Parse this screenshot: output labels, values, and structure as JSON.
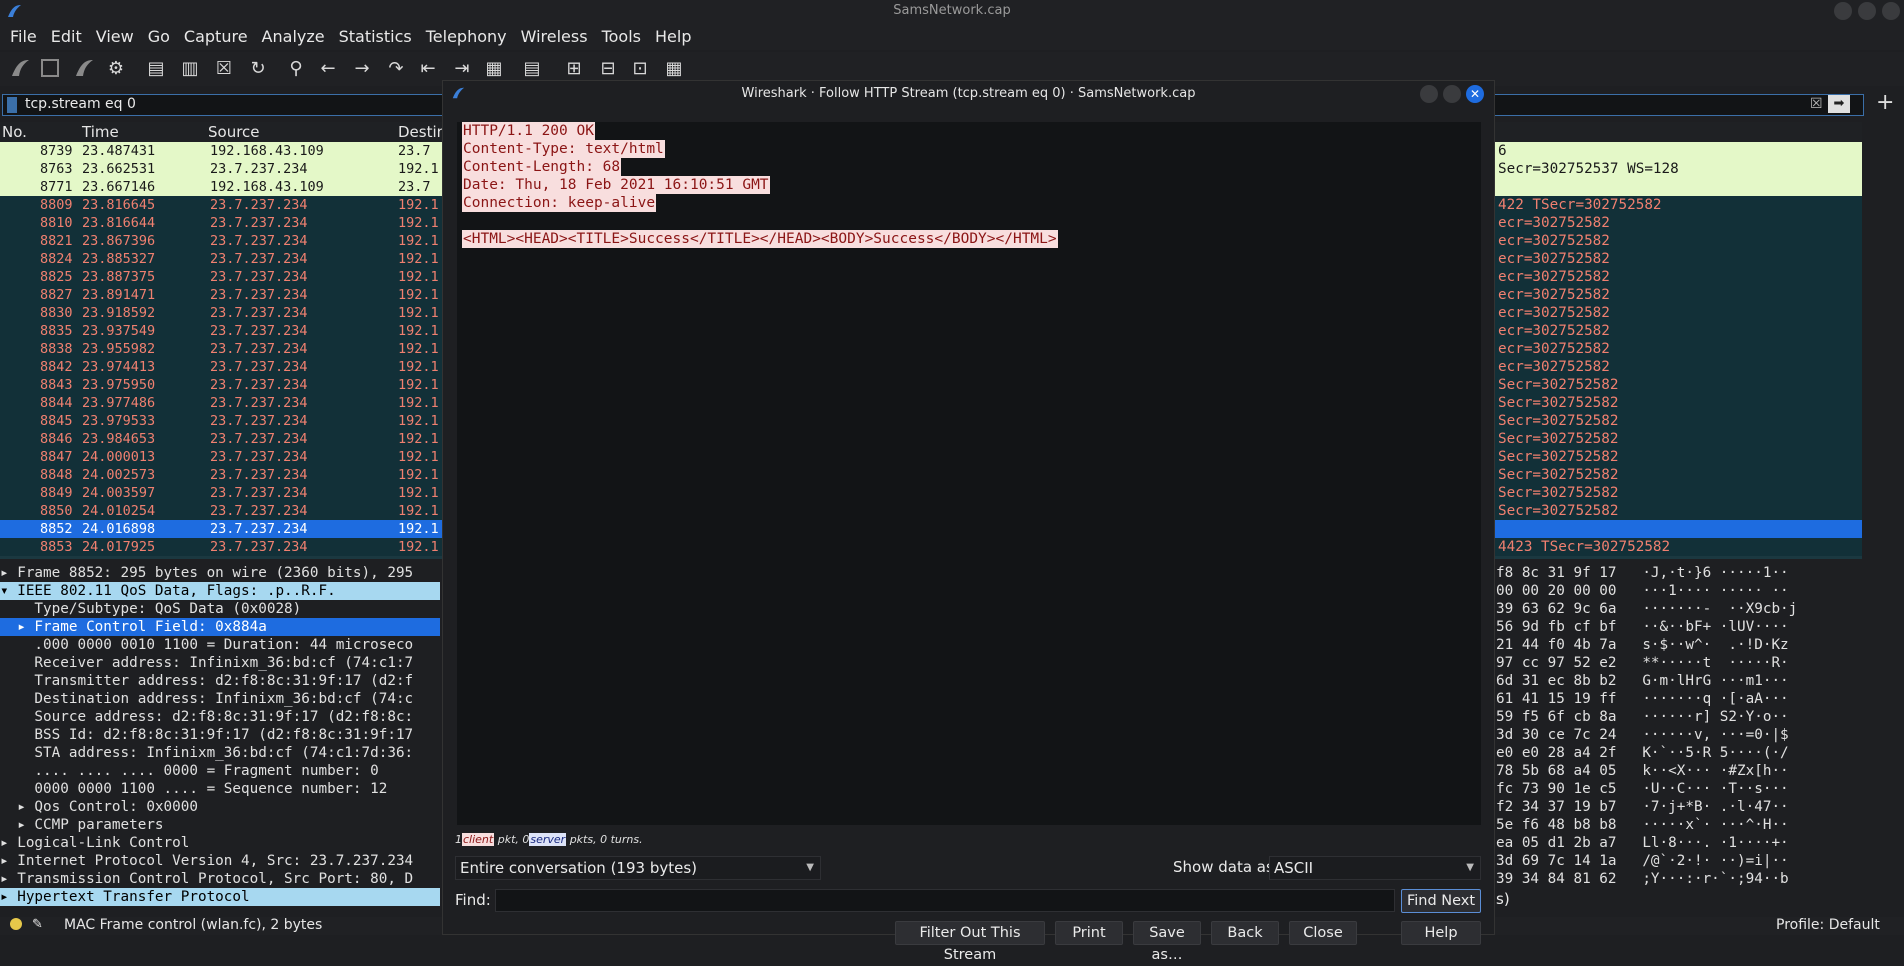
{
  "window_title": "SamsNetwork.cap",
  "menu": [
    "File",
    "Edit",
    "View",
    "Go",
    "Capture",
    "Analyze",
    "Statistics",
    "Telephony",
    "Wireless",
    "Tools",
    "Help"
  ],
  "filter_text": "tcp.stream eq 0",
  "columns": {
    "no": "No.",
    "time": "Time",
    "source": "Source",
    "dest": "Destin"
  },
  "packets": [
    {
      "no": "8739",
      "time": "23.487431",
      "src": "192.168.43.109",
      "dst": "23.7",
      "style": "green"
    },
    {
      "no": "8763",
      "time": "23.662531",
      "src": "23.7.237.234",
      "dst": "192.1",
      "style": "green"
    },
    {
      "no": "8771",
      "time": "23.667146",
      "src": "192.168.43.109",
      "dst": "23.7",
      "style": "green"
    },
    {
      "no": "8809",
      "time": "23.816645",
      "src": "23.7.237.234",
      "dst": "192.1",
      "style": "dark"
    },
    {
      "no": "8810",
      "time": "23.816644",
      "src": "23.7.237.234",
      "dst": "192.1",
      "style": "dark"
    },
    {
      "no": "8821",
      "time": "23.867396",
      "src": "23.7.237.234",
      "dst": "192.1",
      "style": "dark"
    },
    {
      "no": "8824",
      "time": "23.885327",
      "src": "23.7.237.234",
      "dst": "192.1",
      "style": "dark"
    },
    {
      "no": "8825",
      "time": "23.887375",
      "src": "23.7.237.234",
      "dst": "192.1",
      "style": "dark"
    },
    {
      "no": "8827",
      "time": "23.891471",
      "src": "23.7.237.234",
      "dst": "192.1",
      "style": "dark"
    },
    {
      "no": "8830",
      "time": "23.918592",
      "src": "23.7.237.234",
      "dst": "192.1",
      "style": "dark"
    },
    {
      "no": "8835",
      "time": "23.937549",
      "src": "23.7.237.234",
      "dst": "192.1",
      "style": "dark"
    },
    {
      "no": "8838",
      "time": "23.955982",
      "src": "23.7.237.234",
      "dst": "192.1",
      "style": "dark"
    },
    {
      "no": "8842",
      "time": "23.974413",
      "src": "23.7.237.234",
      "dst": "192.1",
      "style": "dark"
    },
    {
      "no": "8843",
      "time": "23.975950",
      "src": "23.7.237.234",
      "dst": "192.1",
      "style": "dark"
    },
    {
      "no": "8844",
      "time": "23.977486",
      "src": "23.7.237.234",
      "dst": "192.1",
      "style": "dark"
    },
    {
      "no": "8845",
      "time": "23.979533",
      "src": "23.7.237.234",
      "dst": "192.1",
      "style": "dark"
    },
    {
      "no": "8846",
      "time": "23.984653",
      "src": "23.7.237.234",
      "dst": "192.1",
      "style": "dark"
    },
    {
      "no": "8847",
      "time": "24.000013",
      "src": "23.7.237.234",
      "dst": "192.1",
      "style": "dark"
    },
    {
      "no": "8848",
      "time": "24.002573",
      "src": "23.7.237.234",
      "dst": "192.1",
      "style": "dark"
    },
    {
      "no": "8849",
      "time": "24.003597",
      "src": "23.7.237.234",
      "dst": "192.1",
      "style": "dark"
    },
    {
      "no": "8850",
      "time": "24.010254",
      "src": "23.7.237.234",
      "dst": "192.1",
      "style": "dark"
    },
    {
      "no": "8852",
      "time": "24.016898",
      "src": "23.7.237.234",
      "dst": "192.1",
      "style": "sel"
    },
    {
      "no": "8853",
      "time": "24.017925",
      "src": "23.7.237.234",
      "dst": "192.1",
      "style": "dark"
    }
  ],
  "right_info": [
    "6",
    "Secr=302752537 WS=128",
    "",
    "422 TSecr=302752582",
    "ecr=302752582",
    "ecr=302752582",
    "ecr=302752582",
    "ecr=302752582",
    "ecr=302752582",
    "ecr=302752582",
    "ecr=302752582",
    "ecr=302752582",
    "ecr=302752582",
    "Secr=302752582",
    "Secr=302752582",
    "Secr=302752582",
    "Secr=302752582",
    "Secr=302752582",
    "Secr=302752582",
    "Secr=302752582",
    "Secr=302752582",
    "",
    "4423 TSecr=302752582"
  ],
  "details": [
    {
      "text": "▸ Frame 8852: 295 bytes on wire (2360 bits), 295",
      "style": ""
    },
    {
      "text": "▾ IEEE 802.11 QoS Data, Flags: .p..R.F.",
      "style": "hl"
    },
    {
      "text": "    Type/Subtype: QoS Data (0x0028)",
      "style": ""
    },
    {
      "text": "  ▸ Frame Control Field: 0x884a",
      "style": "sel"
    },
    {
      "text": "    .000 0000 0010 1100 = Duration: 44 microseco",
      "style": ""
    },
    {
      "text": "    Receiver address: Infinixm_36:bd:cf (74:c1:7",
      "style": ""
    },
    {
      "text": "    Transmitter address: d2:f8:8c:31:9f:17 (d2:f",
      "style": ""
    },
    {
      "text": "    Destination address: Infinixm_36:bd:cf (74:c",
      "style": ""
    },
    {
      "text": "    Source address: d2:f8:8c:31:9f:17 (d2:f8:8c:",
      "style": ""
    },
    {
      "text": "    BSS Id: d2:f8:8c:31:9f:17 (d2:f8:8c:31:9f:17",
      "style": ""
    },
    {
      "text": "    STA address: Infinixm_36:bd:cf (74:c1:7d:36:",
      "style": ""
    },
    {
      "text": "    .... .... .... 0000 = Fragment number: 0",
      "style": ""
    },
    {
      "text": "    0000 0000 1100 .... = Sequence number: 12",
      "style": ""
    },
    {
      "text": "  ▸ Qos Control: 0x0000",
      "style": ""
    },
    {
      "text": "  ▸ CCMP parameters",
      "style": ""
    },
    {
      "text": "▸ Logical-Link Control",
      "style": ""
    },
    {
      "text": "▸ Internet Protocol Version 4, Src: 23.7.237.234",
      "style": ""
    },
    {
      "text": "▸ Transmission Control Protocol, Src Port: 80, D",
      "style": ""
    },
    {
      "text": "▸ Hypertext Transfer Protocol",
      "style": "hl"
    }
  ],
  "hex": [
    "f8 8c 31 9f 17   ·J,·t·}6 ·····1··",
    "00 00 20 00 00   ···1···· ····· ··",
    "39 63 62 9c 6a   ·······-  ··X9cb·j",
    "56 9d fb cf bf   ··&··bF+ ·lUV····",
    "21 44 f0 4b 7a   s·$··w^·  .·!D·Kz",
    "97 cc 97 52 e2   **·····t  ·····R·",
    "6d 31 ec 8b b2   G·m·lHrG ···m1···",
    "61 41 15 19 ff   ·······q ·[·aA···",
    "59 f5 6f cb 8a   ······r] S2·Y·o··",
    "3d 30 ce 7c 24   ······v, ···=0·|$",
    "e0 e0 28 a4 2f   K·`··5·R 5····(·/",
    "78 5b 68 a4 05   k··<X··· ·#Zx[h··",
    "fc 73 90 1e c5   ·U··C··· ·T··s···",
    "f2 34 37 19 b7   ·7·j+*B· .·l·47··",
    "5e f6 48 b8 b8   ·····x`· ···^·H··",
    "ea 05 d1 2b a7   Ll·8···. ·1····+·",
    "3d 69 7c 14 1a   /@`·2·!· ··)=i|··",
    "39 34 84 81 62   ;Y···:·r·`·;94··b"
  ],
  "status": {
    "text": "MAC Frame control (wlan.fc), 2 bytes",
    "profile": "Profile: Default",
    "frag": "s)"
  },
  "dialog": {
    "title": "Wireshark · Follow HTTP Stream (tcp.stream eq 0) · SamsNetwork.cap",
    "stream_lines": [
      "HTTP/1.1 200 OK",
      "Content-Type: text/html",
      "Content-Length: 68",
      "Date: Thu, 18 Feb 2021 16:10:51 GMT",
      "Connection: keep-alive",
      "",
      "<HTML><HEAD><TITLE>Success</TITLE></HEAD><BODY>Success</BODY></HTML>"
    ],
    "info_prefix": "1",
    "info_client": "client",
    "info_mid": " pkt, 0",
    "info_server": "server",
    "info_suffix": " pkts, 0 turns.",
    "conversation": "Entire conversation (193 bytes)",
    "show_as_label": "Show data as",
    "show_as_value": "ASCII",
    "find_label": "Find:",
    "find_value": "",
    "find_next": "Find Next",
    "buttons": [
      "Filter Out This Stream",
      "Print",
      "Save as…",
      "Back",
      "Close",
      "Help"
    ]
  }
}
